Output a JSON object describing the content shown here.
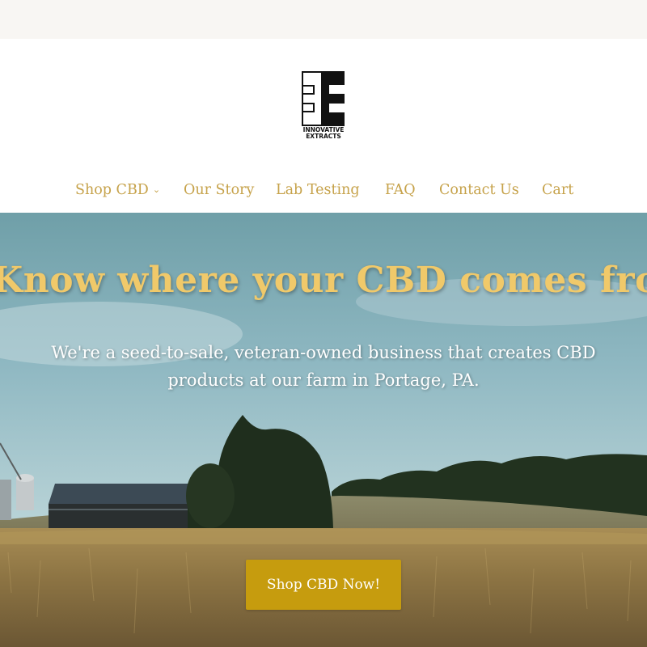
{
  "logo": {
    "line1": "INNOVATIVE",
    "line2": "EXTRACTS"
  },
  "nav": {
    "items": [
      {
        "label": "Shop CBD",
        "chevron": "⌄"
      },
      {
        "label": "Our Story"
      },
      {
        "label": "Lab Testing"
      },
      {
        "label": "FAQ"
      },
      {
        "label": "Contact Us"
      },
      {
        "label": "Cart"
      }
    ]
  },
  "hero": {
    "title": "Know where your CBD comes from.",
    "subtitle_line1": "We're a seed-to-sale, veteran-owned business that creates CBD",
    "subtitle_line2": "products at our farm in Portage, PA.",
    "button_label": "Shop CBD Now!"
  },
  "colors": {
    "nav_text": "#c6a24a",
    "hero_title": "#f0c96a",
    "button_bg": "#c69c0e",
    "topbar_bg": "#f8f6f3"
  },
  "icons": {
    "dropdown": "chevron-down-icon",
    "logo": "innovative-extracts-logo"
  }
}
